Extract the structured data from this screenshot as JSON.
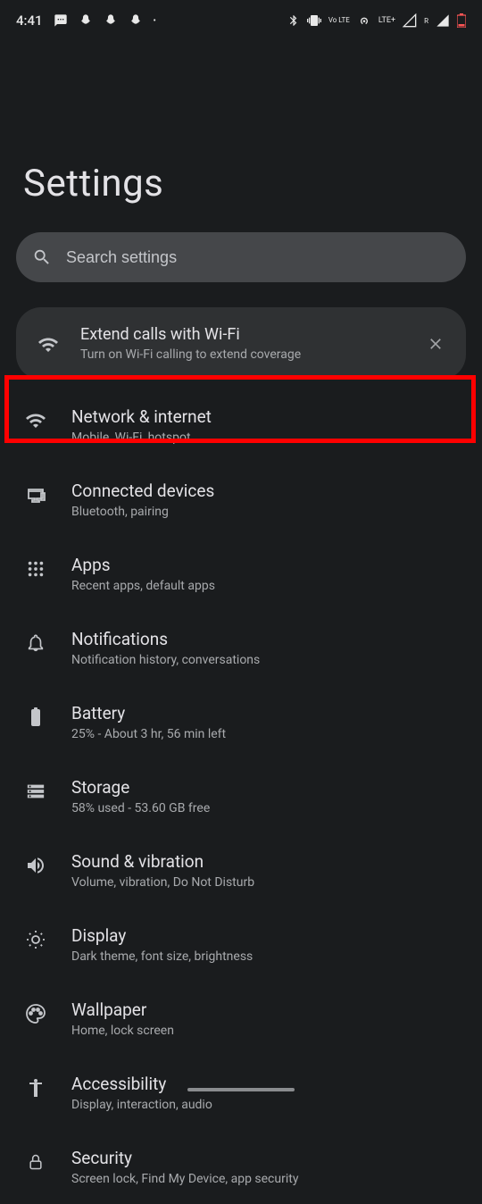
{
  "status": {
    "time": "4:41",
    "lte_label": "LTE+",
    "volte_label": "Vo LTE",
    "r_label": "R"
  },
  "page": {
    "title": "Settings"
  },
  "search": {
    "placeholder": "Search settings"
  },
  "suggestion": {
    "title": "Extend calls with Wi-Fi",
    "subtitle": "Turn on Wi-Fi calling to extend coverage"
  },
  "items": [
    {
      "title": "Network & internet",
      "subtitle": "Mobile, Wi-Fi, hotspot"
    },
    {
      "title": "Connected devices",
      "subtitle": "Bluetooth, pairing"
    },
    {
      "title": "Apps",
      "subtitle": "Recent apps, default apps"
    },
    {
      "title": "Notifications",
      "subtitle": "Notification history, conversations"
    },
    {
      "title": "Battery",
      "subtitle": "25% - About 3 hr, 56 min left"
    },
    {
      "title": "Storage",
      "subtitle": "58% used - 53.60 GB free"
    },
    {
      "title": "Sound & vibration",
      "subtitle": "Volume, vibration, Do Not Disturb"
    },
    {
      "title": "Display",
      "subtitle": "Dark theme, font size, brightness"
    },
    {
      "title": "Wallpaper",
      "subtitle": "Home, lock screen"
    },
    {
      "title": "Accessibility",
      "subtitle": "Display, interaction, audio"
    },
    {
      "title": "Security",
      "subtitle": "Screen lock, Find My Device, app security"
    }
  ]
}
